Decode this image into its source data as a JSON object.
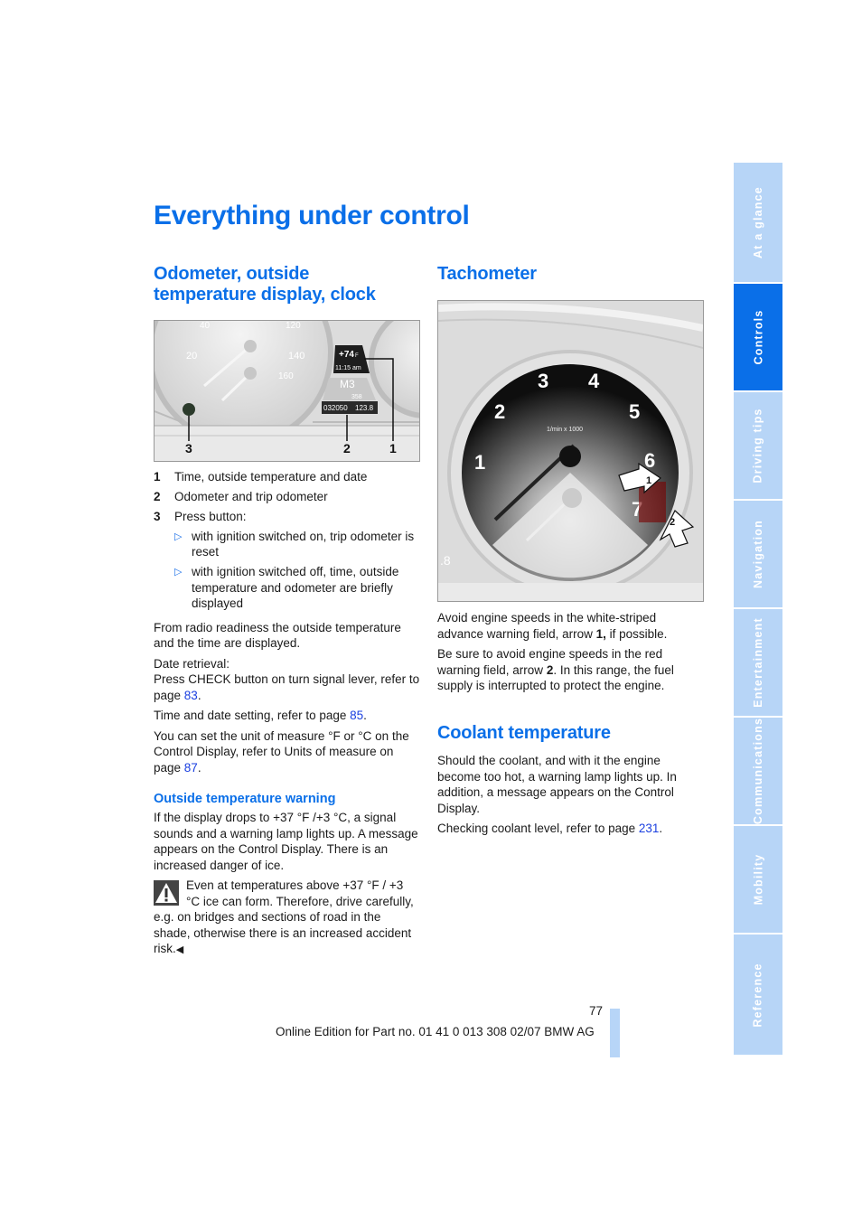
{
  "page": {
    "title": "Everything under control",
    "page_number": "77",
    "footer": "Online Edition for Part no. 01 41 0 013 308 02/07 BMW AG"
  },
  "side_tabs": [
    {
      "label": "At a glance",
      "active": false
    },
    {
      "label": "Controls",
      "active": true
    },
    {
      "label": "Driving tips",
      "active": false
    },
    {
      "label": "Navigation",
      "active": false
    },
    {
      "label": "Entertainment",
      "active": false
    },
    {
      "label": "Communications",
      "active": false
    },
    {
      "label": "Mobility",
      "active": false
    },
    {
      "label": "Reference",
      "active": false
    }
  ],
  "odometer": {
    "heading": "Odometer, outside temperature display, clock",
    "figure": {
      "temp": "+74",
      "temp_unit": "°F",
      "time": "11:15 am",
      "model": "M3",
      "range": "358",
      "odometer": "032050",
      "trip": "123.8",
      "callouts": [
        "3",
        "2",
        "1"
      ],
      "speed_ticks": [
        "40",
        "120",
        "20",
        "140",
        "160"
      ]
    },
    "items": [
      {
        "num": "1",
        "text": "Time, outside temperature and date"
      },
      {
        "num": "2",
        "text": "Odometer and trip odometer"
      },
      {
        "num": "3",
        "text": "Press button:"
      }
    ],
    "sub_items": [
      "with ignition switched on, trip odometer is reset",
      "with ignition switched off, time, outside temperature and odometer are briefly displayed"
    ],
    "para_radio": "From radio readiness the outside temperature and the time are displayed.",
    "date_retrieval_label": "Date retrieval:",
    "date_retrieval_text": "Press CHECK button on turn signal lever, refer to page ",
    "date_retrieval_page": "83",
    "time_setting_text": "Time and date setting, refer to page ",
    "time_setting_page": "85",
    "unit_text": "You can set the unit of measure °F  or °C on the Control Display, refer to Units of measure on page ",
    "unit_page": "87",
    "warning_heading": "Outside temperature warning",
    "warning_text": "If the display drops to +37 °F /+3 °C, a signal sounds and a warning lamp lights up. A message appears on the Control Display. There is an increased danger of ice.",
    "caution_text": "Even at temperatures above +37 °F / +3 °C ice can form. Therefore, drive carefully, e.g. on bridges and sections of road in the shade, otherwise there is an increased accident risk."
  },
  "tachometer": {
    "heading": "Tachometer",
    "figure": {
      "scale_label": "1/min x 1000",
      "numbers": [
        "1",
        "2",
        "3",
        "4",
        "5",
        "6",
        "7"
      ],
      "arrows": [
        "1",
        "2"
      ],
      "side_value": ".8"
    },
    "para1_a": "Avoid engine speeds in the white-striped advance warning field, arrow ",
    "para1_b": "1,",
    "para1_c": " if possible.",
    "para2_a": "Be sure to avoid engine speeds in the red warning field, arrow ",
    "para2_b": "2",
    "para2_c": ". In this range, the fuel supply is interrupted to protect the engine."
  },
  "coolant": {
    "heading": "Coolant temperature",
    "para1": "Should the coolant, and with it the engine become too hot, a warning lamp lights up. In addition, a message appears on the Control Display.",
    "para2_text": "Checking coolant level, refer to page ",
    "para2_page": "231"
  }
}
